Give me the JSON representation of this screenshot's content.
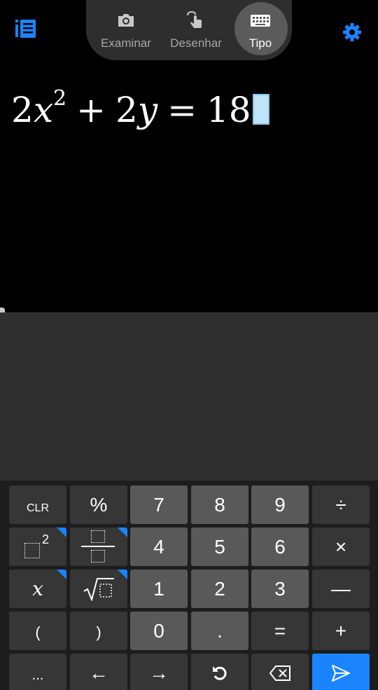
{
  "top_bar": {
    "history_icon": "list-icon",
    "settings_icon": "gear-icon",
    "accent_color": "#1a84ff",
    "modes": [
      {
        "label": "Examinar",
        "icon": "camera-icon",
        "active": false
      },
      {
        "label": "Desenhar",
        "icon": "hand-draw-icon",
        "active": false
      },
      {
        "label": "Tipo",
        "icon": "keyboard-icon",
        "active": true
      }
    ]
  },
  "equation": {
    "coef1": "2",
    "var1": "x",
    "exp1": "2",
    "op1": "+",
    "coef2": "2",
    "var2": "y",
    "eq": "=",
    "rhs": "18"
  },
  "keypad": {
    "row1": [
      "CLR",
      "%",
      "7",
      "8",
      "9",
      "÷"
    ],
    "row2": [
      "square-template",
      "fraction-template",
      "4",
      "5",
      "6",
      "×"
    ],
    "row3": [
      "x",
      "sqrt-template",
      "1",
      "2",
      "3",
      "—"
    ],
    "row4": [
      "(",
      ")",
      "0",
      ".",
      "=",
      "+"
    ],
    "row5": [
      "...",
      "←",
      "→",
      "undo-icon",
      "backspace-icon",
      "send-icon"
    ],
    "exponent_label": "2"
  }
}
